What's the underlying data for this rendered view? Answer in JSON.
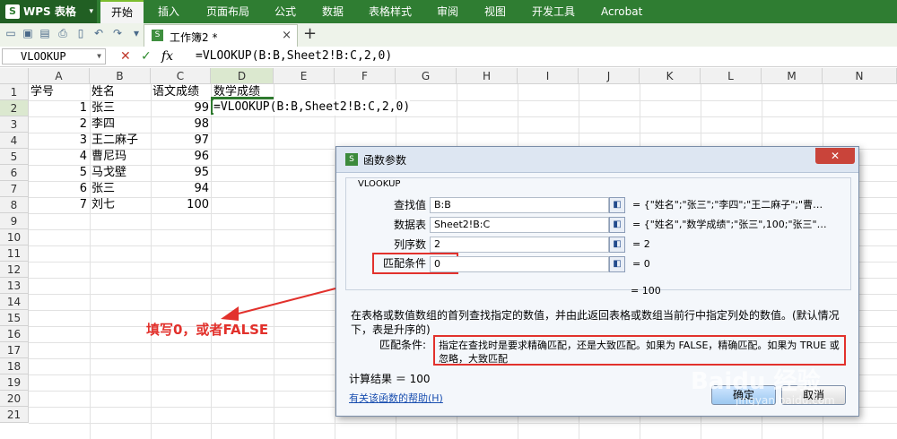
{
  "app": {
    "name": "WPS 表格"
  },
  "menu": [
    "开始",
    "插入",
    "页面布局",
    "公式",
    "数据",
    "表格样式",
    "审阅",
    "视图",
    "开发工具",
    "Acrobat"
  ],
  "tab": {
    "name": "工作簿2 *",
    "close": "×",
    "new": "+"
  },
  "formula_bar": {
    "name_box": "VLOOKUP",
    "cancel": "✕",
    "confirm": "✓",
    "fx": "fx",
    "formula": "=VLOOKUP(B:B,Sheet2!B:C,2,0)"
  },
  "columns": [
    "A",
    "B",
    "C",
    "D",
    "E",
    "F",
    "G",
    "H",
    "I",
    "J",
    "K",
    "L",
    "M",
    "N"
  ],
  "rows": [
    "1",
    "2",
    "3",
    "4",
    "5",
    "6",
    "7",
    "8",
    "9",
    "10",
    "11",
    "12",
    "13",
    "14",
    "15",
    "16",
    "17",
    "18",
    "19",
    "20",
    "21"
  ],
  "headers": {
    "a": "学号",
    "b": "姓名",
    "c": "语文成绩",
    "d": "数学成绩"
  },
  "records": [
    {
      "id": "1",
      "name": "张三",
      "score": "99"
    },
    {
      "id": "2",
      "name": "李四",
      "score": "98"
    },
    {
      "id": "3",
      "name": "王二麻子",
      "score": "97"
    },
    {
      "id": "4",
      "name": "曹尼玛",
      "score": "96"
    },
    {
      "id": "5",
      "name": "马戈壁",
      "score": "95"
    },
    {
      "id": "6",
      "name": "张三",
      "score": "94"
    },
    {
      "id": "7",
      "name": "刘七",
      "score": "100"
    }
  ],
  "active_cell_text": "=VLOOKUP(B:B,Sheet2!B:C,2,0)",
  "dialog": {
    "title": "函数参数",
    "close": "✕",
    "function_name": "VLOOKUP",
    "params": [
      {
        "label": "查找值",
        "value": "B:B",
        "result": "= {\"姓名\";\"张三\";\"李四\";\"王二麻子\";\"曹…"
      },
      {
        "label": "数据表",
        "value": "Sheet2!B:C",
        "result": "= {\"姓名\",\"数学成绩\";\"张三\",100;\"张三\"…"
      },
      {
        "label": "列序数",
        "value": "2",
        "result": "= 2"
      },
      {
        "label": "匹配条件",
        "value": "0",
        "result": "= 0"
      }
    ],
    "total_result": "= 100",
    "description": "在表格或数值数组的首列查找指定的数值，并由此返回表格或数组当前行中指定列处的数值。(默认情况下，表是升序的)",
    "param_label": "匹配条件:",
    "param_description": "指定在查找时是要求精确匹配，还是大致匹配。如果为 FALSE，精确匹配。如果为 TRUE 或忽略，大致匹配",
    "calc_result": "计算结果 ＝ 100",
    "help_link": "有关该函数的帮助(H)",
    "ok": "确定",
    "cancel": "取消"
  },
  "annotation": "填写0，或者FALSE",
  "watermark": {
    "main": "Baidu 经验",
    "sub": "jingyan.baidu.com"
  },
  "colors": {
    "menu_green": "#2f7d32",
    "annotation_red": "#e2312c",
    "active_cell": "#2e7a2e"
  }
}
